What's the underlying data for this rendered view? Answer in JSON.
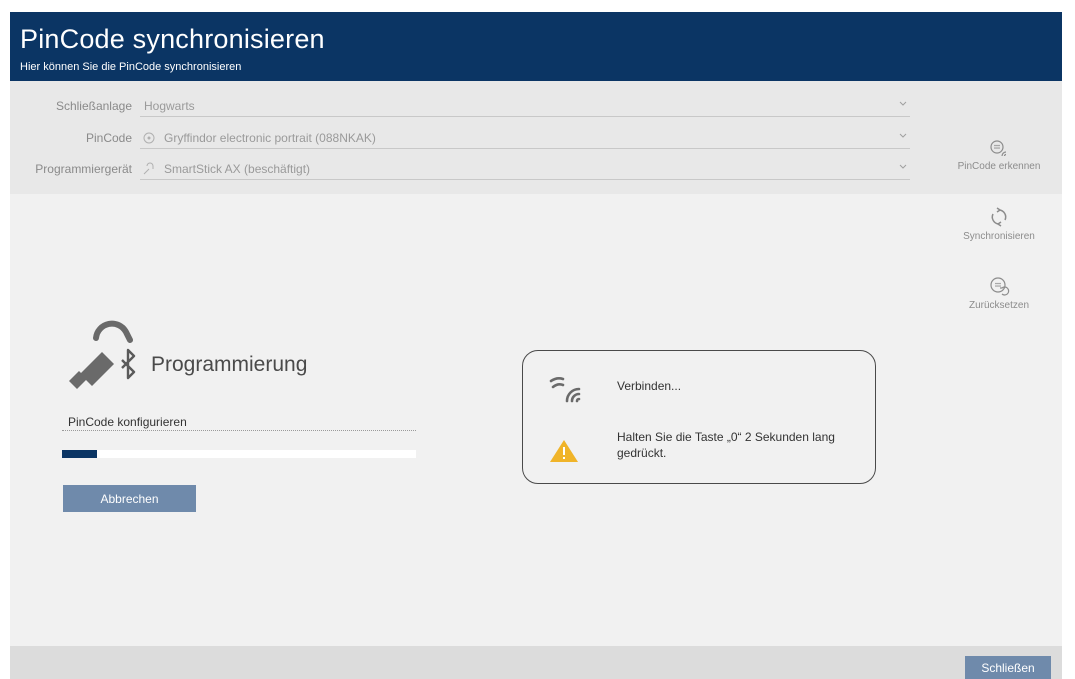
{
  "header": {
    "title": "PinCode synchronisieren",
    "subtitle": "Hier können Sie die PinCode synchronisieren"
  },
  "form": {
    "locking_system": {
      "label": "Schließanlage",
      "value": "Hogwarts"
    },
    "pincode": {
      "label": "PinCode",
      "value": "Gryffindor electronic portrait (088NKAK)"
    },
    "programmer": {
      "label": "Programmiergerät",
      "value": "SmartStick AX (beschäftigt)"
    }
  },
  "side_actions": {
    "detect": "PinCode erkennen",
    "sync": "Synchronisieren",
    "reset": "Zurücksetzen"
  },
  "programming": {
    "title": "Programmierung",
    "step": "PinCode konfigurieren",
    "progress": 0.1,
    "cancel": "Abbrechen"
  },
  "status": {
    "connecting": "Verbinden...",
    "instruction": "Halten Sie die Taste „0“ 2 Sekunden lang gedrückt."
  },
  "footer": {
    "close": "Schließen"
  },
  "colors": {
    "header_bg": "#0b3564",
    "button_bg": "#6f8aab",
    "warning": "#f0b429"
  },
  "icons": {
    "pincode": "pincode-wireless-icon",
    "sync": "sync-icon",
    "reset": "pincode-reset-icon",
    "programmer": "smartstick-bluetooth-icon",
    "connecting": "wireless-signal-icon",
    "warning": "warning-triangle-icon"
  }
}
